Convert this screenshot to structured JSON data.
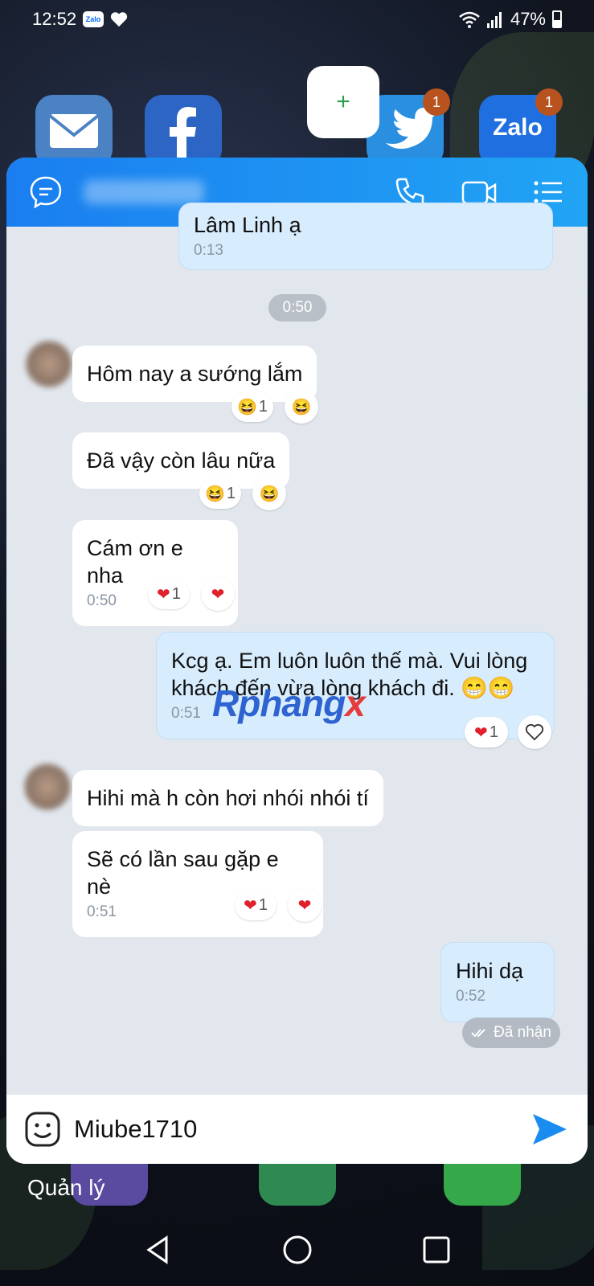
{
  "status_bar": {
    "time": "12:52",
    "zalo_mini_label": "Zalo",
    "battery_percent": "47%"
  },
  "home": {
    "apps": [
      {
        "name": "mail-app",
        "badge": ""
      },
      {
        "name": "facebook-app",
        "badge": ""
      },
      {
        "name": "twitter-app",
        "badge": "1"
      },
      {
        "name": "zalo-app",
        "label": "Zalo",
        "badge": "1"
      }
    ],
    "plus_label": "+"
  },
  "chat": {
    "partial_message": {
      "text": "Lâm Linh ạ",
      "time": "0:13"
    },
    "time_divider": "0:50",
    "messages": [
      {
        "text": "Hôm nay a sướng lắm",
        "react_count": "1"
      },
      {
        "text": "Đã vậy còn lâu nữa",
        "react_count": "1"
      },
      {
        "text": "Cám ơn e nha",
        "time": "0:50",
        "react_count": "1"
      },
      {
        "text": "Kcg ạ. Em luôn luôn thế mà. Vui lòng khách đến vừa lòng khách đi. 😁😁",
        "time": "0:51",
        "react_count": "1"
      },
      {
        "text": "Hihi mà h còn hơi nhói nhói tí"
      },
      {
        "text": "Sẽ có lần sau gặp e nè",
        "time": "0:51",
        "react_count": "1"
      },
      {
        "text": "Hihi dạ",
        "time": "0:52"
      }
    ],
    "delivery_status": "Đã nhận",
    "input_value": "Miube1710",
    "watermark_a": "Rphang",
    "watermark_b": "x"
  },
  "dock": {
    "label": "Quản lý"
  },
  "colors": {
    "header_start": "#1a7ef0",
    "header_end": "#21a4f4",
    "chat_bg": "#e2e7ee",
    "outgoing_bubble": "#d7ecfd",
    "send_blue": "#1a8cf0"
  }
}
